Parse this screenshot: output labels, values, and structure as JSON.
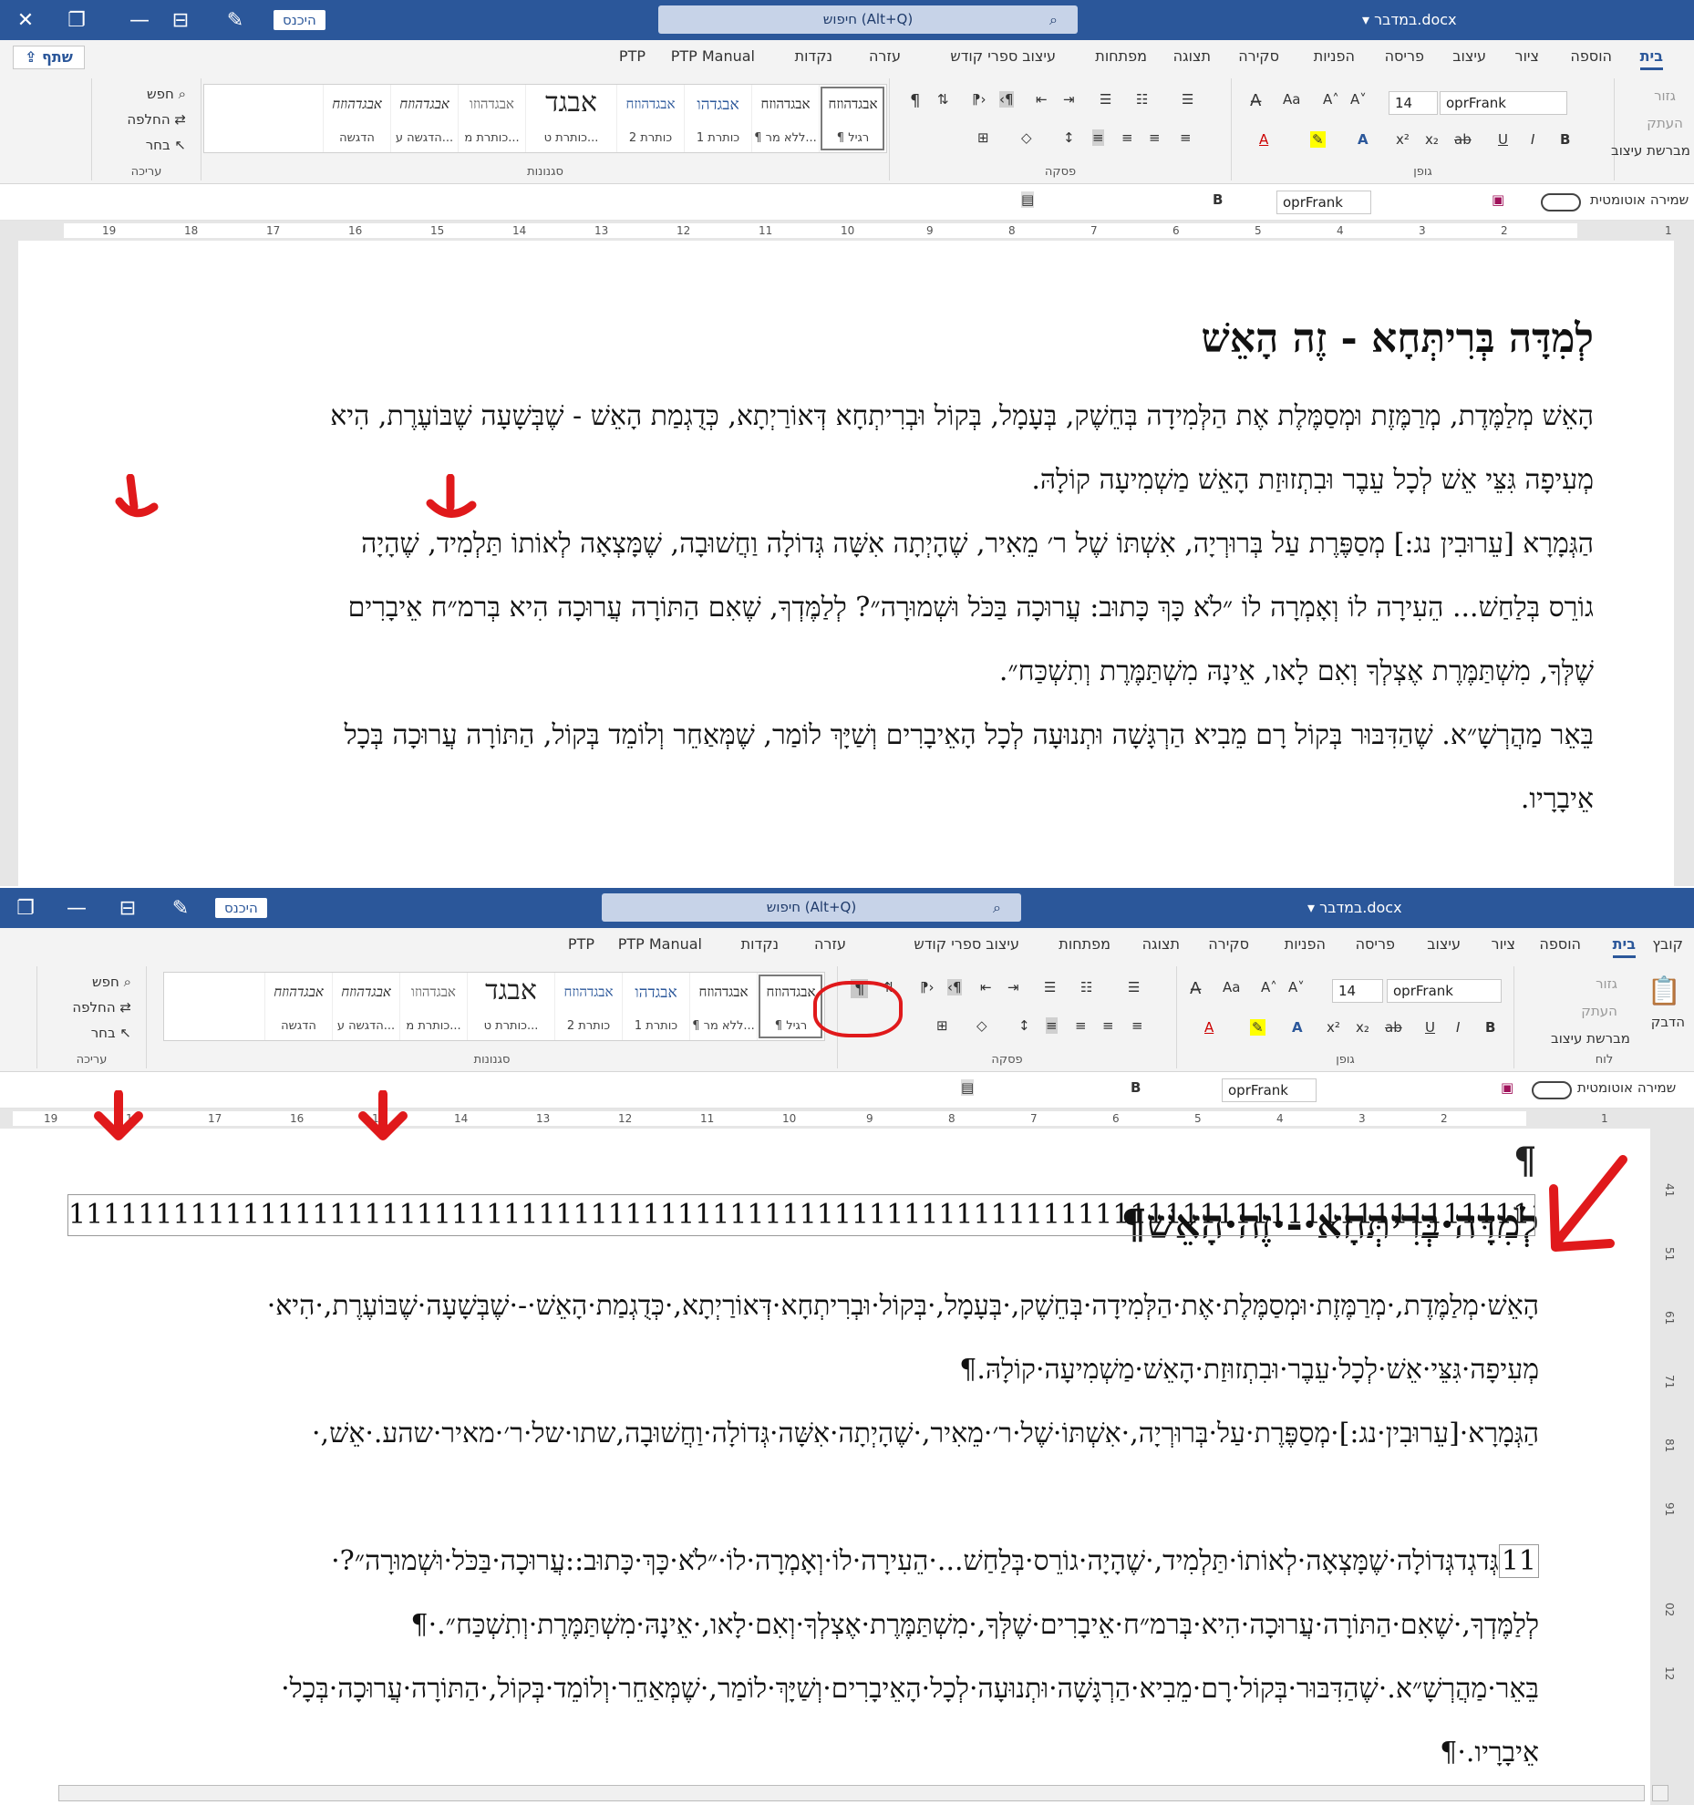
{
  "app": {
    "doc_title": "במדבר.docx",
    "search_placeholder": "חיפוש (Alt+Q)",
    "sign_in": "היכנס",
    "share": "שתף"
  },
  "tabs": [
    "קובץ",
    "בית",
    "הוספה",
    "ציור",
    "עיצוב",
    "פריסה",
    "הפניות",
    "סקירה",
    "תצוגה",
    "מפתחות",
    "עיצוב ספרי קודש",
    "עזרה",
    "נקדות",
    "PTP Manual",
    "PTP"
  ],
  "ribbon": {
    "groups": [
      "לוח",
      "גופן",
      "פסקה",
      "סגנונות",
      "עריכה"
    ],
    "clipboard": {
      "paste": "הדבק",
      "cut": "גזור",
      "copy": "העתק",
      "format_painter": "מברשת עיצוב"
    },
    "font": {
      "name": "oprFrank",
      "size": "14"
    },
    "styles": [
      {
        "preview": "אבגדהוזח",
        "name": "¶ רגיל"
      },
      {
        "preview": "אבגדהוזח",
        "name": "¶ ללא מר..."
      },
      {
        "preview": "אבגדהו",
        "name": "כותרת 1"
      },
      {
        "preview": "אבגדהוזח",
        "name": "כותרת 2"
      },
      {
        "preview": "אבגד",
        "name": "כותרת ט..."
      },
      {
        "preview": "אבגדהוזו",
        "name": "כותרת מ..."
      },
      {
        "preview": "אבגדהוזח",
        "name": "הדגשה ע..."
      },
      {
        "preview": "אבגדהוזח",
        "name": "הדגשה"
      }
    ],
    "editing": {
      "find": "חפש",
      "replace": "החלפה",
      "select": "בחר"
    },
    "autosave": "שמירה אוטומטית",
    "qat_font": "oprFrank"
  },
  "ruler_numbers": [
    "1",
    "2",
    "3",
    "4",
    "5",
    "6",
    "7",
    "8",
    "9",
    "10",
    "11",
    "12",
    "13",
    "14",
    "15",
    "16",
    "17",
    "18",
    "19"
  ],
  "vertical_ruler": [
    "41",
    "51",
    "61",
    "71",
    "81",
    "91",
    "02",
    "12"
  ],
  "docA": {
    "heading": "לְמִדָּה בְּרִיתְּחָא - זֶה הָאֵשׁ",
    "lines": [
      "הָאֵשׁ מְלַמֶּדֶת, מְרַמֶּזֶת וּמְסַמֶּלֶת אֶת הַלְּמִידָה בְּחֵשֶׁק, בְּעָמָל, בְּקוֹל וּבְרִיתְחָא דְּאוֹרַיְתָא, כְּדֻגְמַת הָאֵשׁ - שֶׁבְּשָׁעָה שֶׁבּוֹעֶרֶת, הִיא",
      "מְעִיפָה גִּצֵּי אֵשׁ לְכָל עֵבֶר וּבִתְזוּזַת הָאֵשׁ מַשְׁמִיעָה קוֹלָהּ.",
      "הַגְּמָרָא [עֵרוּבִין נג:] מְסַפֶּרֶת עַל בְּרוּרְיָה, אִשְׁתּוֹ שֶׁל ר׳ מֵאִיר, שֶׁהָיְתָה אִשָּׁה גְּדוֹלָה וַחֲשׁוּבָה, שֶׁמָּצְאָה לְאוֹתוֹ תַּלְמִיד, שֶׁהָיָה",
      "גוֹרֵס בְּלַחַשׁ... הֵעִירָה לוֹ וְאָמְרָה לוֹ ״לֹא כָּךְ כָּתוּב: עֲרוּכָה בַּכֹּל וּשְׁמוּרָה״? לְלַמֶּדְךָ, שֶׁאִם הַתּוֹרָה עֲרוּכָה הִיא בְּרמ״ח אֵיבָרִים",
      "שֶׁלְּךָ, מִשְׁתַּמֶּרֶת אֶצְלְךָ וְאִם לָאו, אֵינָהּ מִשְׁתַּמֶּרֶת וְתִשְׁכַּח״.",
      "בֵּאֵר מַהֲרְשָׁ״א. שֶׁהַדִּבּוּר בְּקוֹל רָם מֵבִיא הַרְגָּשָׁה וּתְנוּעָה לְכָל הָאֵיבָרִים וְשַׁיָּךְ לוֹמַר, שֶׁמְּאַחֵר וְלוֹמֵד בְּקוֹל, הַתּוֹרָה עֲרוּכָה בְּכָל",
      "אֵיבָרָיו."
    ]
  },
  "docB": {
    "top_mark": "¶",
    "heading": "לְמִדָּה·בְּרִיתְּחָא·-·זֶה·הָאֵשׁ¶",
    "lines": [
      "הָאֵשׁ·מְלַמֶּדֶת,·מְרַמֶּזֶת·וּמְסַמֶּלֶת·אֶת·הַלְּמִידָה·בְּחֵשֶׁק,·בְּעָמָל,·בְּקוֹל·וּבְרִיתְחָא·דְּאוֹרַיְתָא,·כְּדֻגְמַת·הָאֵשׁ·-·שֶׁבְּשָׁעָה·שֶׁבּוֹעֶרֶת,·הִיא·",
      "מְעִיפָה·גִּצֵּי·אֵשׁ·לְכָל·עֵבֶר·וּבִתְזוּזַת·הָאֵשׁ·מַשְׁמִיעָה·קוֹלָהּ.¶",
      "הַגְּמָרָא·[עֵרוּבִין·נג:]·מְסַפֶּרֶת·עַל·בְּרוּרְיָה,·אִשְׁתּוֹ·שֶׁל·ר׳·מֵאִיר,·שֶׁהָיְתָה·אִשָּׁה·גְּדוֹלָה·וַחֲשׁוּבָה,שתו·של·ר׳·מאיר·שהע.·אֵשׁ,·"
    ],
    "ones_row": "1111111111111111111111111111111111111111111111111111111111111111111111111111111111111111111111111111",
    "ones_lead": "ו",
    "line_after_ones_prefix": "11",
    "lines2": [
      "גְּדגְדגְּדוֹלָה·שֶׁמָּצְאָה·לְאוֹתוֹ·תַּלְמִיד,·שֶׁהָיָה·גוֹרֵס·בְּלַחַשׁ...·הֵעִירָה·לוֹ·וְאָמְרָה·לוֹ·״לֹא·כָּךְ·כָּתוּב::עֲרוּכָה·בַּכֹּל·וּשְׁמוּרָה״?·",
      "לְלַמֶּדְךָ,·שֶׁאִם·הַתּוֹרָה·עֲרוּכָה·הִיא·בְּרמ״ח·אֵיבָרִים·שֶׁלְּךָ,·מִשְׁתַּמֶּרֶת·אֶצְלְךָ·וְאִם·לָאו,·אֵינָהּ·מִשְׁתַּמֶּרֶת·וְתִשְׁכַּח״.·¶",
      "בֵּאֵר·מַהֲרְשָׁ״א.·שֶׁהַדִּבּוּר·בְּקוֹל·רָם·מֵבִיא·הַרְגָּשָׁה·וּתְנוּעָה·לְכָל·הָאֵיבָרִים·וְשַׁיָּךְ·לוֹמַר,·שֶׁמְּאַחֵר·וְלוֹמֵד·בְּקוֹל,·הַתּוֹרָה·עֲרוּכָה·בְּכָל·",
      "אֵיבָרָיו.·¶"
    ]
  },
  "colors": {
    "titlebar": "#2b579a",
    "annotation": "#e0191b",
    "squiggle": "#d13438"
  }
}
